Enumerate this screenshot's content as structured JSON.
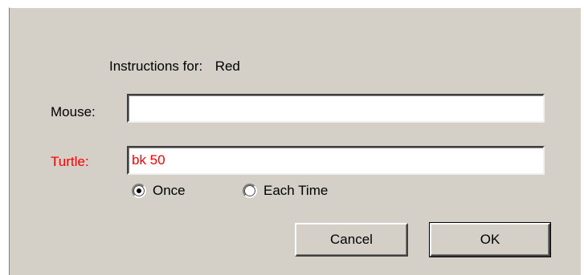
{
  "dialog": {
    "instructions_prefix": "Instructions for:",
    "instructions_target": "Red",
    "mouse_label": "Mouse:",
    "mouse_value": "",
    "turtle_label": "Turtle:",
    "turtle_value": "bk 50",
    "radio_once": "Once",
    "radio_each_time": "Each Time",
    "radio_selected": "Once",
    "cancel_label": "Cancel",
    "ok_label": "OK"
  },
  "colors": {
    "dialog_bg": "#d4d0c8",
    "turtle_accent": "#ff0000"
  }
}
